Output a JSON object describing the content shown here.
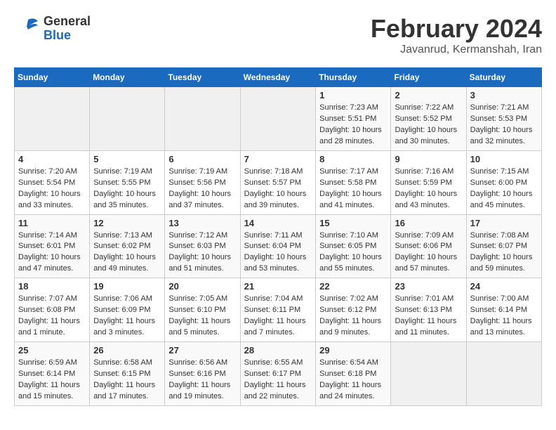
{
  "header": {
    "logo_line1": "General",
    "logo_line2": "Blue",
    "month_title": "February 2024",
    "location": "Javanrud, Kermanshah, Iran"
  },
  "days_of_week": [
    "Sunday",
    "Monday",
    "Tuesday",
    "Wednesday",
    "Thursday",
    "Friday",
    "Saturday"
  ],
  "weeks": [
    [
      {
        "day": "",
        "info": ""
      },
      {
        "day": "",
        "info": ""
      },
      {
        "day": "",
        "info": ""
      },
      {
        "day": "",
        "info": ""
      },
      {
        "day": "1",
        "sunrise": "7:23 AM",
        "sunset": "5:51 PM",
        "daylight": "10 hours and 28 minutes."
      },
      {
        "day": "2",
        "sunrise": "7:22 AM",
        "sunset": "5:52 PM",
        "daylight": "10 hours and 30 minutes."
      },
      {
        "day": "3",
        "sunrise": "7:21 AM",
        "sunset": "5:53 PM",
        "daylight": "10 hours and 32 minutes."
      }
    ],
    [
      {
        "day": "4",
        "sunrise": "7:20 AM",
        "sunset": "5:54 PM",
        "daylight": "10 hours and 33 minutes."
      },
      {
        "day": "5",
        "sunrise": "7:19 AM",
        "sunset": "5:55 PM",
        "daylight": "10 hours and 35 minutes."
      },
      {
        "day": "6",
        "sunrise": "7:19 AM",
        "sunset": "5:56 PM",
        "daylight": "10 hours and 37 minutes."
      },
      {
        "day": "7",
        "sunrise": "7:18 AM",
        "sunset": "5:57 PM",
        "daylight": "10 hours and 39 minutes."
      },
      {
        "day": "8",
        "sunrise": "7:17 AM",
        "sunset": "5:58 PM",
        "daylight": "10 hours and 41 minutes."
      },
      {
        "day": "9",
        "sunrise": "7:16 AM",
        "sunset": "5:59 PM",
        "daylight": "10 hours and 43 minutes."
      },
      {
        "day": "10",
        "sunrise": "7:15 AM",
        "sunset": "6:00 PM",
        "daylight": "10 hours and 45 minutes."
      }
    ],
    [
      {
        "day": "11",
        "sunrise": "7:14 AM",
        "sunset": "6:01 PM",
        "daylight": "10 hours and 47 minutes."
      },
      {
        "day": "12",
        "sunrise": "7:13 AM",
        "sunset": "6:02 PM",
        "daylight": "10 hours and 49 minutes."
      },
      {
        "day": "13",
        "sunrise": "7:12 AM",
        "sunset": "6:03 PM",
        "daylight": "10 hours and 51 minutes."
      },
      {
        "day": "14",
        "sunrise": "7:11 AM",
        "sunset": "6:04 PM",
        "daylight": "10 hours and 53 minutes."
      },
      {
        "day": "15",
        "sunrise": "7:10 AM",
        "sunset": "6:05 PM",
        "daylight": "10 hours and 55 minutes."
      },
      {
        "day": "16",
        "sunrise": "7:09 AM",
        "sunset": "6:06 PM",
        "daylight": "10 hours and 57 minutes."
      },
      {
        "day": "17",
        "sunrise": "7:08 AM",
        "sunset": "6:07 PM",
        "daylight": "10 hours and 59 minutes."
      }
    ],
    [
      {
        "day": "18",
        "sunrise": "7:07 AM",
        "sunset": "6:08 PM",
        "daylight": "11 hours and 1 minute."
      },
      {
        "day": "19",
        "sunrise": "7:06 AM",
        "sunset": "6:09 PM",
        "daylight": "11 hours and 3 minutes."
      },
      {
        "day": "20",
        "sunrise": "7:05 AM",
        "sunset": "6:10 PM",
        "daylight": "11 hours and 5 minutes."
      },
      {
        "day": "21",
        "sunrise": "7:04 AM",
        "sunset": "6:11 PM",
        "daylight": "11 hours and 7 minutes."
      },
      {
        "day": "22",
        "sunrise": "7:02 AM",
        "sunset": "6:12 PM",
        "daylight": "11 hours and 9 minutes."
      },
      {
        "day": "23",
        "sunrise": "7:01 AM",
        "sunset": "6:13 PM",
        "daylight": "11 hours and 11 minutes."
      },
      {
        "day": "24",
        "sunrise": "7:00 AM",
        "sunset": "6:14 PM",
        "daylight": "11 hours and 13 minutes."
      }
    ],
    [
      {
        "day": "25",
        "sunrise": "6:59 AM",
        "sunset": "6:14 PM",
        "daylight": "11 hours and 15 minutes."
      },
      {
        "day": "26",
        "sunrise": "6:58 AM",
        "sunset": "6:15 PM",
        "daylight": "11 hours and 17 minutes."
      },
      {
        "day": "27",
        "sunrise": "6:56 AM",
        "sunset": "6:16 PM",
        "daylight": "11 hours and 19 minutes."
      },
      {
        "day": "28",
        "sunrise": "6:55 AM",
        "sunset": "6:17 PM",
        "daylight": "11 hours and 22 minutes."
      },
      {
        "day": "29",
        "sunrise": "6:54 AM",
        "sunset": "6:18 PM",
        "daylight": "11 hours and 24 minutes."
      },
      {
        "day": "",
        "info": ""
      },
      {
        "day": "",
        "info": ""
      }
    ]
  ],
  "labels": {
    "sunrise": "Sunrise:",
    "sunset": "Sunset:",
    "daylight": "Daylight:"
  }
}
